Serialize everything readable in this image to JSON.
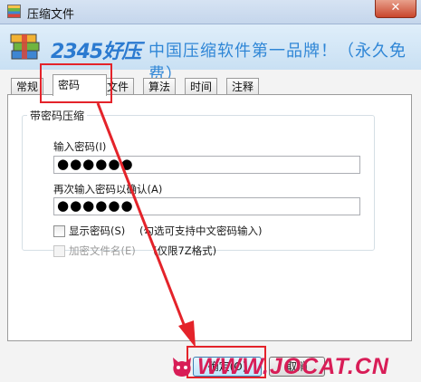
{
  "window": {
    "title": "压缩文件",
    "close_glyph": "✕"
  },
  "banner": {
    "logo": "2345好压",
    "slogan": "中国压缩软件第一品牌！（永久免费）"
  },
  "tabs": [
    "常规",
    "密码",
    "文件",
    "算法",
    "时间",
    "注释"
  ],
  "active_tab": "密码",
  "group": {
    "legend": "带密码压缩",
    "password_label": "输入密码(I)",
    "password_value": "●●●●●●",
    "confirm_label": "再次输入密码以确认(A)",
    "confirm_value": "●●●●●●",
    "show_password": {
      "label": "显示密码(S)",
      "note": "(勾选可支持中文密码输入)",
      "checked": false
    },
    "encrypt_filenames": {
      "label": "加密文件名(E)",
      "note": "(仅限7Z格式)",
      "checked": false,
      "enabled": false
    }
  },
  "buttons": {
    "ok": "确定(O)",
    "cancel": "取消"
  },
  "watermark": "WWW.JOCAT.CN",
  "colors": {
    "annotation": "#e4232a",
    "watermark": "#d81d57",
    "brand_blue": "#2b7ad0"
  },
  "icons": {
    "app": "winrar-style-books-icon",
    "logo": "books-stack-icon",
    "mascot": "cat-head-icon"
  }
}
